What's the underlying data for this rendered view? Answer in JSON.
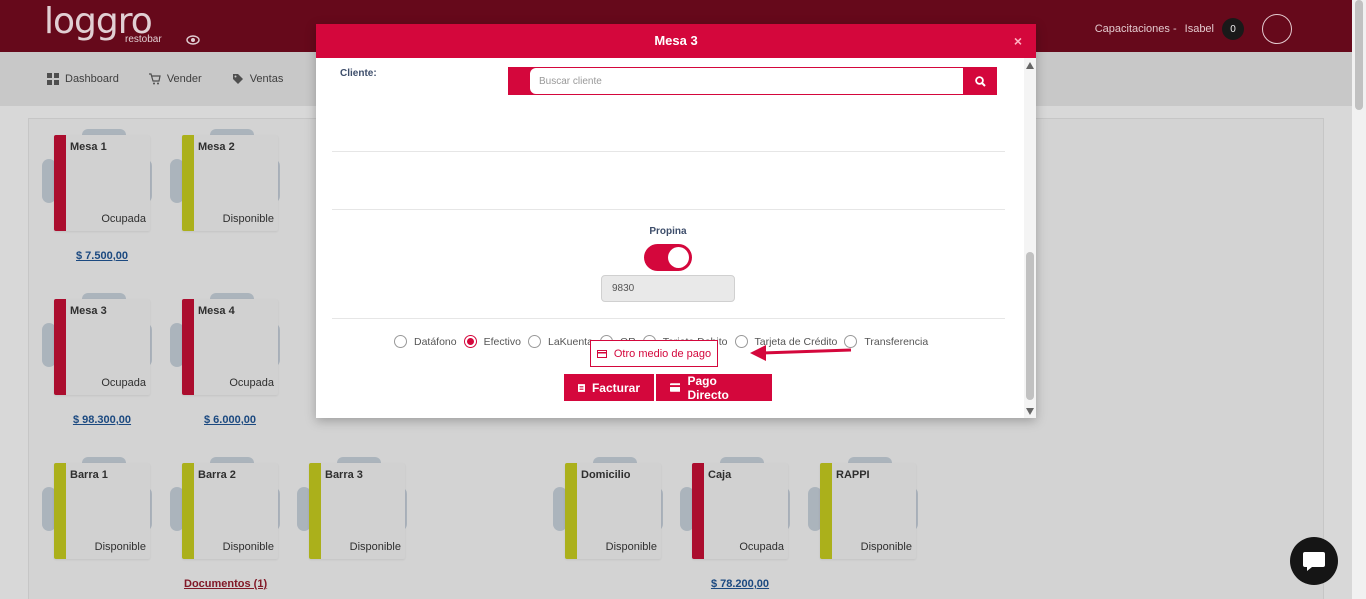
{
  "app": {
    "logo_text": "loggro",
    "logo_sub": "restobar",
    "user_company": "Capacitaciones -",
    "user_name": "Isabel",
    "notif_count": "0"
  },
  "nav": {
    "items": [
      {
        "label": "Dashboard",
        "icon": "dashboard-icon"
      },
      {
        "label": "Vender",
        "icon": "cart-icon"
      },
      {
        "label": "Ventas",
        "icon": "tag-icon"
      }
    ]
  },
  "tables": [
    {
      "name": "Mesa 1",
      "status": "Ocupada",
      "amount": "$ 7.500,00",
      "color": "#b80f32"
    },
    {
      "name": "Mesa 2",
      "status": "Disponible",
      "amount": "",
      "color": "#b9be1e"
    },
    {
      "name": "Mesa 3",
      "status": "Ocupada",
      "amount": "$ 98.300,00",
      "color": "#b80f32"
    },
    {
      "name": "Mesa 4",
      "status": "Ocupada",
      "amount": "$ 6.000,00",
      "color": "#b80f32"
    },
    {
      "name": "Barra 1",
      "status": "Disponible",
      "amount": "",
      "color": "#b9be1e"
    },
    {
      "name": "Barra 2",
      "status": "Disponible",
      "amount": "",
      "color": "#b9be1e"
    },
    {
      "name": "Barra 3",
      "status": "Disponible",
      "amount": "",
      "color": "#b9be1e"
    },
    {
      "name": "Domicilio",
      "status": "Disponible",
      "amount": "",
      "color": "#b9be1e"
    },
    {
      "name": "Caja",
      "status": "Ocupada",
      "amount": "$ 78.200,00",
      "color": "#b80f32"
    },
    {
      "name": "RAPPI",
      "status": "Disponible",
      "amount": "",
      "color": "#b9be1e"
    }
  ],
  "documents_link": "Documentos (1)",
  "modal": {
    "title": "Mesa 3",
    "close": "×",
    "cliente_label": "Cliente:",
    "search_placeholder": "Buscar cliente",
    "propina_label": "Propina",
    "propina_on": true,
    "propina_value": "9830",
    "payment_methods": [
      {
        "label": "Datáfono",
        "selected": false
      },
      {
        "label": "Efectivo",
        "selected": true
      },
      {
        "label": "LaKuenta",
        "selected": false
      },
      {
        "label": "QR",
        "selected": false
      },
      {
        "label": "Tarjeta Debito",
        "selected": false
      },
      {
        "label": "Tarjeta de Crédito",
        "selected": false
      },
      {
        "label": "Transferencia",
        "selected": false
      }
    ],
    "otro_medio_label": "Otro medio de pago",
    "facturar_label": "Facturar",
    "pago_directo_label": "Pago Directo"
  },
  "colors": {
    "brand": "#d4073c",
    "topbar": "#6e0a1e",
    "occupied": "#b80f32",
    "available": "#b9be1e",
    "amount_link": "#1e4f8a"
  }
}
